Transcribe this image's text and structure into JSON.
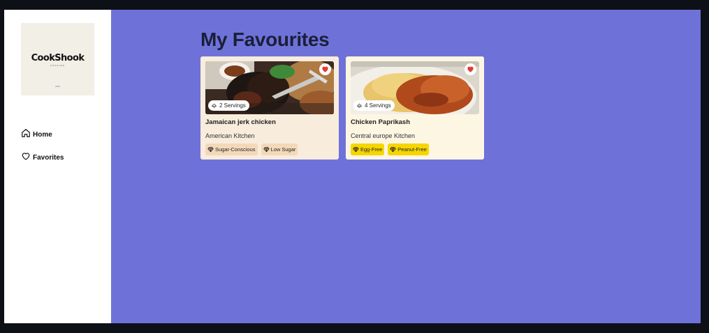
{
  "sidebar": {
    "logo": {
      "title": "CookShook",
      "subtitle": "COOKING",
      "mark": "2023"
    },
    "nav": [
      {
        "label": "Home",
        "icon": "home-icon"
      },
      {
        "label": "Favorites",
        "icon": "heart-outline-icon"
      }
    ]
  },
  "main": {
    "title": "My Favourites",
    "cards": [
      {
        "name": "Jamaican jerk chicken",
        "cuisine": "American Kitchen",
        "servings": "2 Servings",
        "tags": [
          "Sugar-Conscious",
          "Low Sugar"
        ]
      },
      {
        "name": "Chicken Paprikash",
        "cuisine": "Central europe Kitchen",
        "servings": "4 Servings",
        "tags": [
          "Egg-Free",
          "Peanut-Free"
        ]
      }
    ]
  },
  "colors": {
    "sidebar_bg": "#ffffff",
    "main_bg": "#6e72d8",
    "title": "#1a1f3a",
    "card1_bg": "#f8ecdd",
    "card2_bg": "#fdf6e3",
    "tag1_bg": "#f3d9b9",
    "tag2_bg": "#f7d600",
    "heart": "#e53935"
  }
}
